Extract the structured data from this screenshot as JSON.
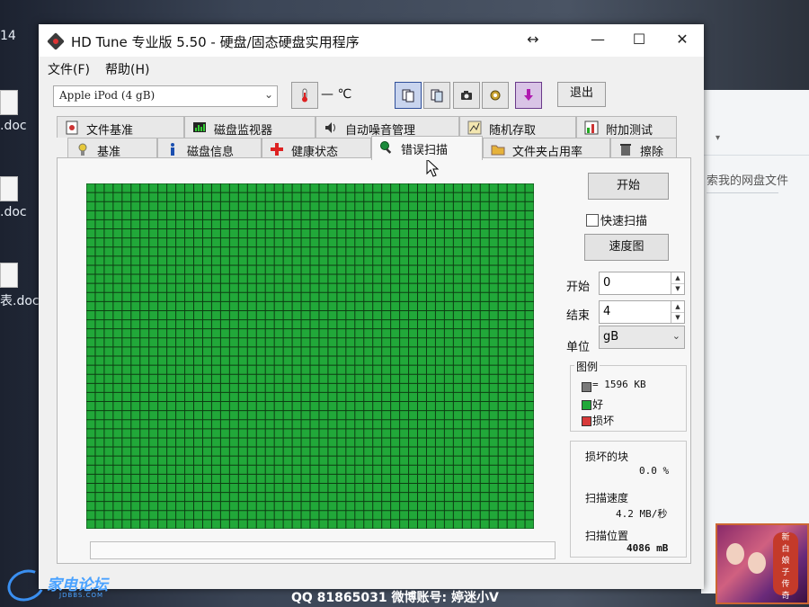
{
  "window": {
    "title": "HD Tune 专业版 5.50 - 硬盘/固态硬盘实用程序",
    "controls": {
      "restore": "↔",
      "minimize": "—",
      "maximize": "☐",
      "close": "✕"
    }
  },
  "menu": {
    "file": "文件(F)",
    "help": "帮助(H)"
  },
  "toolbar": {
    "drive": "Apple   iPod (4 gB)",
    "temperature": "— ℃",
    "exit": "退出"
  },
  "tabs_top": [
    {
      "label": "文件基准",
      "icon": "file-benchmark-icon"
    },
    {
      "label": "磁盘监视器",
      "icon": "monitor-icon"
    },
    {
      "label": "自动噪音管理",
      "icon": "speaker-icon"
    },
    {
      "label": "随机存取",
      "icon": "random-access-icon"
    },
    {
      "label": "附加测试",
      "icon": "extra-tests-icon"
    }
  ],
  "tabs_bottom": [
    {
      "label": "基准",
      "icon": "benchmark-icon"
    },
    {
      "label": "磁盘信息",
      "icon": "info-icon"
    },
    {
      "label": "健康状态",
      "icon": "health-icon"
    },
    {
      "label": "错误扫描",
      "icon": "error-scan-icon",
      "active": true
    },
    {
      "label": "文件夹占用率",
      "icon": "folder-icon"
    },
    {
      "label": "擦除",
      "icon": "erase-icon"
    }
  ],
  "scan": {
    "start_button": "开始",
    "quick_scan": "快速扫描",
    "quick_scan_checked": false,
    "speed_map_button": "速度图",
    "start_label": "开始",
    "start_value": "0",
    "end_label": "结束",
    "end_value": "4",
    "unit_label": "单位",
    "unit_value": "gB",
    "legend": {
      "title": "图例",
      "block_size": "= 1596 KB",
      "good": "好",
      "damaged": "损坏"
    },
    "stats": {
      "damaged_blocks_label": "损坏的块",
      "damaged_blocks_value": "0.0 %",
      "scan_speed_label": "扫描速度",
      "scan_speed_value": "4.2 MB/秒",
      "scan_position_label": "扫描位置",
      "scan_position_value": "4086 mB"
    }
  },
  "colors": {
    "good_block": "#21a839",
    "damaged_block": "#d83a3a",
    "block_border": "#0d3d12",
    "legend_block": "#7a7a7a"
  },
  "background": {
    "desktop_icons": [
      "14",
      ".doc",
      ".doc",
      "表.doc"
    ],
    "search_text": "索我的网盘文件"
  },
  "overlay": {
    "watermark_text": "家电论坛",
    "watermark_sub": "JDBBS.COM",
    "footer": "QQ 81865031 微博账号: 婷迷小V",
    "corner_title": [
      "新",
      "白",
      "娘",
      "子",
      "传",
      "奇"
    ]
  }
}
